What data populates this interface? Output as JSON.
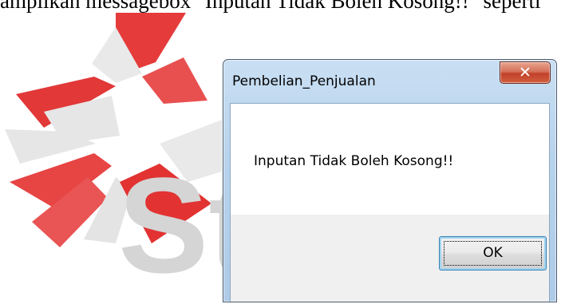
{
  "document": {
    "partial_text": "ampilkan messagebox \"Inputan Tidak Boleh Kosong!!\" seperti"
  },
  "watermark": {
    "text": "St",
    "colors": {
      "red": "#e53b3b",
      "gray": "#d0d0d0"
    }
  },
  "dialog": {
    "title": "Pembelian_Penjualan",
    "close_icon": "close-icon",
    "close_glyph": "✕",
    "message": "Inputan Tidak Boleh Kosong!!",
    "ok_label": "OK"
  }
}
